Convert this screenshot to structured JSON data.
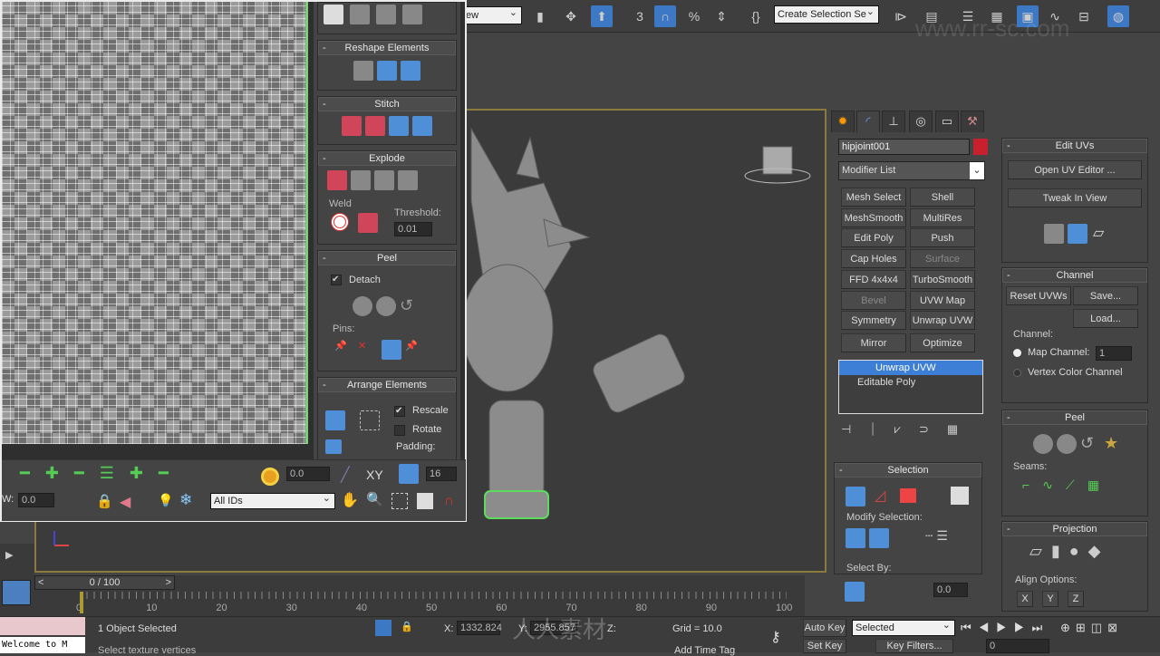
{
  "toolbar": {
    "view_dropdown": "ew",
    "snap_angle": "3",
    "selection_set": "Create Selection Se",
    "watermark": "www.rr-sc.com"
  },
  "uv_editor": {
    "rollouts": {
      "reshape": "Reshape Elements",
      "stitch": "Stitch",
      "explode": "Explode",
      "weld": "Weld",
      "threshold_label": "Threshold:",
      "threshold": "0.01",
      "peel": "Peel",
      "detach": "Detach",
      "detach_checked": true,
      "pins": "Pins:",
      "arrange": "Arrange Elements",
      "rescale": "Rescale",
      "rescale_checked": true,
      "rotate": "Rotate",
      "rotate_checked": false,
      "padding": "Padding:"
    },
    "tools": {
      "soft_value": "0.0",
      "axis": "XY",
      "grid_value": "16",
      "w_label": "W:",
      "w_value": "0.0",
      "id_filter": "All IDs"
    }
  },
  "command_panel": {
    "object_name": "hipjoint001",
    "object_color": "#c8202c",
    "modifier_list": "Modifier List",
    "modifiers": [
      "Mesh Select",
      "Shell",
      "MeshSmooth",
      "MultiRes",
      "Edit Poly",
      "Push",
      "Cap Holes",
      "Surface",
      "FFD 4x4x4",
      "TurboSmooth",
      "Bevel",
      "UVW Map",
      "Symmetry",
      "Unwrap UVW",
      "Mirror",
      "Optimize"
    ],
    "stack": [
      "Unwrap UVW",
      "Editable Poly"
    ],
    "selection": {
      "title": "Selection",
      "modify_selection": "Modify Selection:",
      "select_by": "Select By:",
      "value": "0.0"
    }
  },
  "right_panel": {
    "edit_uvs": {
      "title": "Edit UVs",
      "open_editor": "Open UV Editor ...",
      "tweak": "Tweak In View"
    },
    "channel": {
      "title": "Channel",
      "reset": "Reset UVWs",
      "save": "Save...",
      "load": "Load...",
      "group": "Channel:",
      "map_channel": "Map Channel:",
      "map_value": "1",
      "vertex_color": "Vertex Color Channel",
      "selected_option": "Map Channel"
    },
    "peel": {
      "title": "Peel",
      "seams": "Seams:"
    },
    "projection": {
      "title": "Projection",
      "align": "Align Options:",
      "x": "X",
      "y": "Y",
      "z": "Z"
    }
  },
  "timeline": {
    "frame": "0 / 100",
    "ticks": [
      "0",
      "10",
      "20",
      "30",
      "40",
      "50",
      "60",
      "70",
      "80",
      "90",
      "100"
    ]
  },
  "status": {
    "selected": "1 Object Selected",
    "prompt": "Select texture vertices",
    "x_label": "X:",
    "x": "1332.824",
    "y_label": "Y:",
    "y": "2955.857",
    "z_label": "Z:",
    "grid": "Grid = 10.0",
    "add_time_tag": "Add Time Tag",
    "auto_key": "Auto Key",
    "set_key": "Set Key",
    "key_mode": "Selected",
    "key_filters": "Key Filters...",
    "frame_value": "0",
    "listener": "Welcome to M",
    "watermark": "人人素材"
  }
}
